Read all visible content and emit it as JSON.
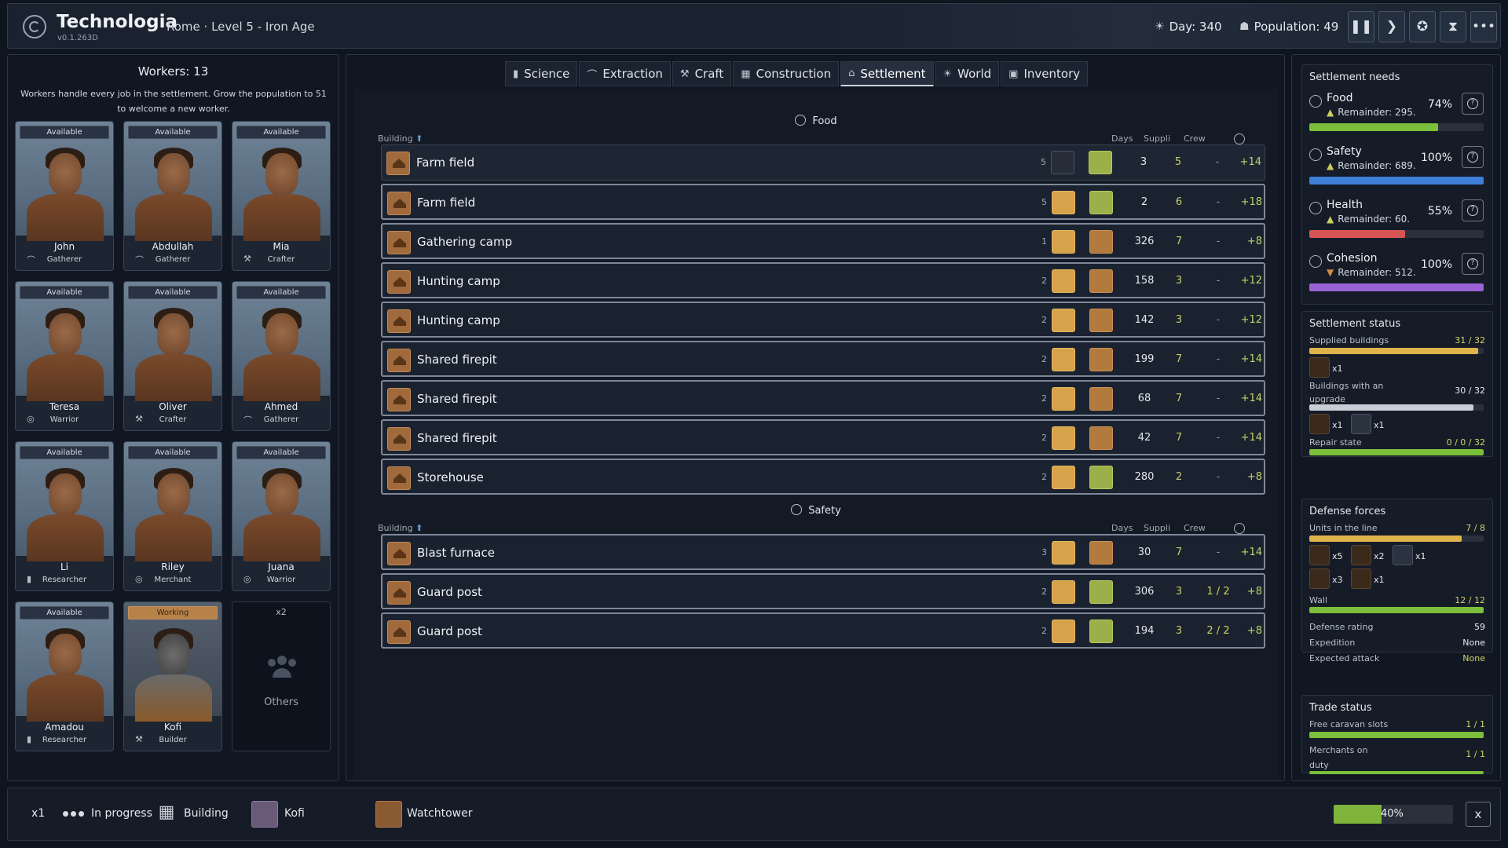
{
  "header": {
    "title": "Technologia",
    "version": "v0.1.263D",
    "subtitle": "Rome · Level 5 - Iron Age",
    "day": "Day: 340",
    "population": "Population: 49"
  },
  "workers": {
    "title": "Workers: 13",
    "description": "Workers handle every job in the settlement. Grow the population to 51 to welcome a new worker.",
    "cards": [
      {
        "status": "Available",
        "name": "John",
        "role": "Gatherer"
      },
      {
        "status": "Available",
        "name": "Abdullah",
        "role": "Gatherer"
      },
      {
        "status": "Available",
        "name": "Mia",
        "role": "Crafter"
      },
      {
        "status": "Available",
        "name": "Teresa",
        "role": "Warrior"
      },
      {
        "status": "Available",
        "name": "Oliver",
        "role": "Crafter"
      },
      {
        "status": "Available",
        "name": "Ahmed",
        "role": "Gatherer"
      },
      {
        "status": "Available",
        "name": "Li",
        "role": "Researcher"
      },
      {
        "status": "Available",
        "name": "Riley",
        "role": "Merchant"
      },
      {
        "status": "Available",
        "name": "Juana",
        "role": "Warrior"
      },
      {
        "status": "Available",
        "name": "Amadou",
        "role": "Researcher"
      },
      {
        "status": "Working",
        "name": "Kofi",
        "role": "Builder"
      }
    ],
    "others": {
      "count": "x2",
      "label": "Others"
    }
  },
  "tabs": [
    "Science",
    "Extraction",
    "Craft",
    "Construction",
    "Settlement",
    "World",
    "Inventory"
  ],
  "active_tab": "Settlement",
  "columns": {
    "building": "Building",
    "days": "Days",
    "supplies": "Suppli",
    "crew": "Crew"
  },
  "food": {
    "title": "Food",
    "rows": [
      {
        "name": "Farm field",
        "level": "5",
        "days": "3",
        "supplies": "5",
        "crew": "-",
        "output": "+14"
      },
      {
        "name": "Farm field",
        "level": "5",
        "days": "2",
        "supplies": "6",
        "crew": "-",
        "output": "+18"
      },
      {
        "name": "Gathering camp",
        "level": "1",
        "days": "326",
        "supplies": "7",
        "crew": "-",
        "output": "+8"
      },
      {
        "name": "Hunting camp",
        "level": "2",
        "days": "158",
        "supplies": "3",
        "crew": "-",
        "output": "+12"
      },
      {
        "name": "Hunting camp",
        "level": "2",
        "days": "142",
        "supplies": "3",
        "crew": "-",
        "output": "+12"
      },
      {
        "name": "Shared firepit",
        "level": "2",
        "days": "199",
        "supplies": "7",
        "crew": "-",
        "output": "+14"
      },
      {
        "name": "Shared firepit",
        "level": "2",
        "days": "68",
        "supplies": "7",
        "crew": "-",
        "output": "+14"
      },
      {
        "name": "Shared firepit",
        "level": "2",
        "days": "42",
        "supplies": "7",
        "crew": "-",
        "output": "+14"
      },
      {
        "name": "Storehouse",
        "level": "2",
        "days": "280",
        "supplies": "2",
        "crew": "-",
        "output": "+8"
      }
    ]
  },
  "safety": {
    "title": "Safety",
    "rows": [
      {
        "name": "Blast furnace",
        "level": "3",
        "days": "30",
        "supplies": "7",
        "crew": "-",
        "output": "+14"
      },
      {
        "name": "Guard post",
        "level": "2",
        "days": "306",
        "supplies": "3",
        "crew": "1 / 2",
        "output": "+8"
      },
      {
        "name": "Guard post",
        "level": "2",
        "days": "194",
        "supplies": "3",
        "crew": "2 / 2",
        "output": "+8"
      }
    ]
  },
  "needs": {
    "title": "Settlement needs",
    "items": [
      {
        "name": "Food",
        "remainder": "Remainder: 295.",
        "percent": "74%",
        "fill": 0.74,
        "color": "#7bbf3a",
        "trend": "up"
      },
      {
        "name": "Safety",
        "remainder": "Remainder: 689.",
        "percent": "100%",
        "fill": 1.0,
        "color": "#3d7fd6",
        "trend": "up"
      },
      {
        "name": "Health",
        "remainder": "Remainder: 60.",
        "percent": "55%",
        "fill": 0.55,
        "color": "#d65454",
        "trend": "up"
      },
      {
        "name": "Cohesion",
        "remainder": "Remainder: 512.",
        "percent": "100%",
        "fill": 1.0,
        "color": "#9b62d6",
        "trend": "down"
      }
    ]
  },
  "status": {
    "title": "Settlement status",
    "supplied_label": "Supplied buildings",
    "supplied_value": "31 / 32",
    "supplied_fill": 0.97,
    "supplied_icon_count": "x1",
    "upgrade_label": "Buildings with an upgrade",
    "upgrade_value": "30 / 32",
    "upgrade_fill": 0.94,
    "upgrade_counts": [
      "x1",
      "x1"
    ],
    "repair_label": "Repair state",
    "repair_value": "0 / 0 / 32",
    "repair_fill": 1.0
  },
  "defense": {
    "title": "Defense forces",
    "units_label": "Units in the line",
    "units_value": "7 / 8",
    "units_fill": 0.875,
    "unit_counts": [
      "x5",
      "x2",
      "x1",
      "x3",
      "x1"
    ],
    "wall_label": "Wall",
    "wall_value": "12 / 12",
    "wall_fill": 1.0,
    "rating_label": "Defense rating",
    "rating_value": "59",
    "expedition_label": "Expedition",
    "expedition_value": "None",
    "attack_label": "Expected attack",
    "attack_value": "None"
  },
  "trade": {
    "title": "Trade status",
    "caravan_label": "Free caravan slots",
    "caravan_value": "1 / 1",
    "merchants_label": "Merchants on duty",
    "merchants_value": "1 / 1"
  },
  "bottom": {
    "count": "x1",
    "state": "In progress",
    "type": "Building",
    "worker": "Kofi",
    "target": "Watchtower",
    "progress_label": "40%",
    "progress": 0.4,
    "close": "x"
  }
}
